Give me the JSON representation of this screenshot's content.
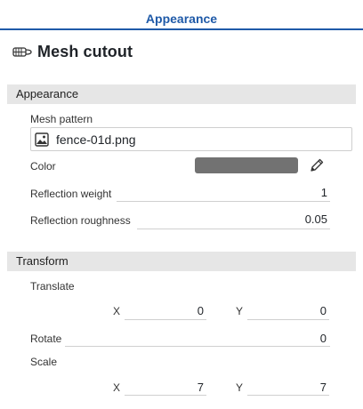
{
  "header": {
    "tab_label": "Appearance"
  },
  "feature": {
    "title": "Mesh cutout",
    "icon": "mesh-cutout-icon"
  },
  "appearance": {
    "section_label": "Appearance",
    "mesh_pattern_label": "Mesh pattern",
    "mesh_pattern_value": "fence-01d.png",
    "color_label": "Color",
    "color_value": "#727272",
    "reflection_weight_label": "Reflection weight",
    "reflection_weight_value": "1",
    "reflection_roughness_label": "Reflection roughness",
    "reflection_roughness_value": "0.05"
  },
  "transform": {
    "section_label": "Transform",
    "translate_label": "Translate",
    "translate_x_label": "X",
    "translate_x_value": "0",
    "translate_y_label": "Y",
    "translate_y_value": "0",
    "rotate_label": "Rotate",
    "rotate_value": "0",
    "scale_label": "Scale",
    "scale_x_label": "X",
    "scale_x_value": "7",
    "scale_y_label": "Y",
    "scale_y_value": "7"
  },
  "colors": {
    "accent": "#1f5aa8",
    "section_bg": "#e6e6e6"
  }
}
